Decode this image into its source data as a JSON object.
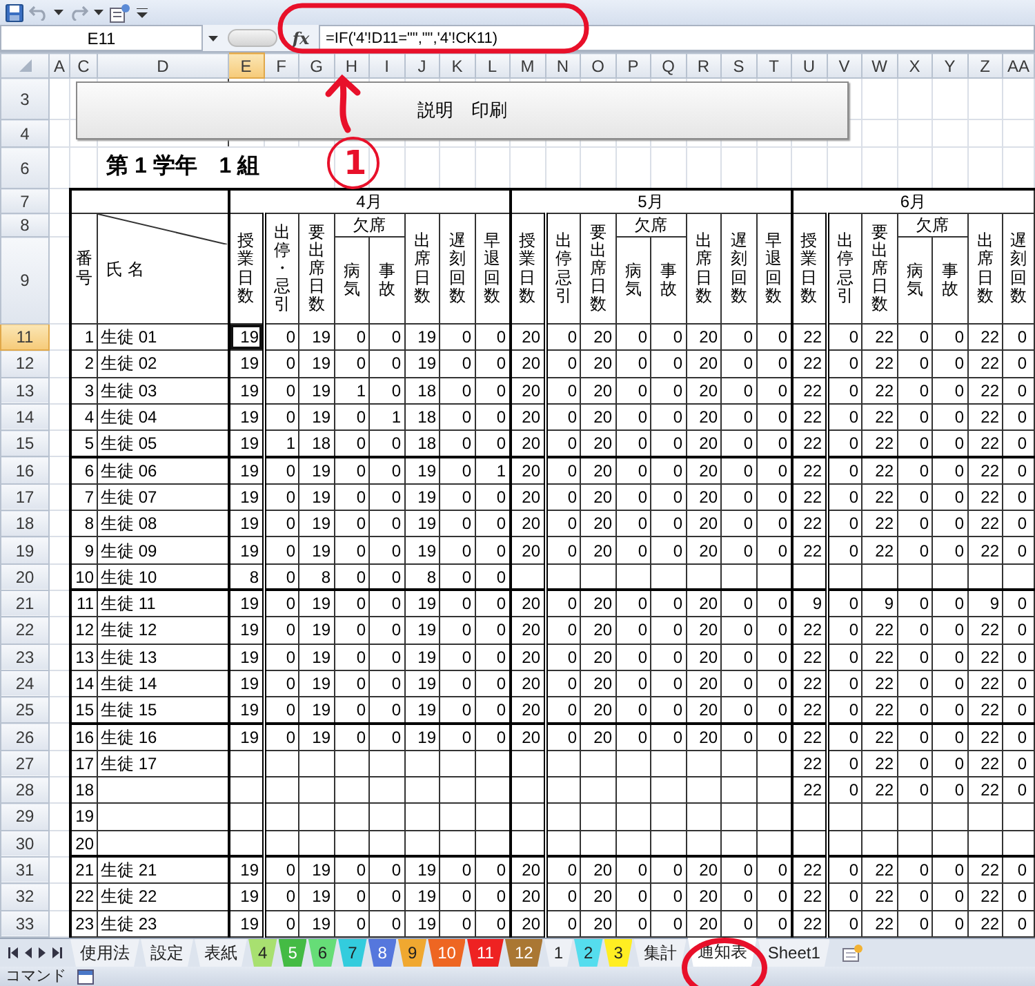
{
  "name_box": "E11",
  "function_button": "fx",
  "formula": "=IF('4'!D11=\"\",\"\",'4'!CK11)",
  "column_headers": [
    {
      "label": "A",
      "selected": false
    },
    {
      "label": "C",
      "selected": false
    },
    {
      "label": "D",
      "selected": false
    },
    {
      "label": "E",
      "selected": true
    },
    {
      "label": "F",
      "selected": false
    },
    {
      "label": "G",
      "selected": false
    },
    {
      "label": "H",
      "selected": false
    },
    {
      "label": "I",
      "selected": false
    },
    {
      "label": "J",
      "selected": false
    },
    {
      "label": "K",
      "selected": false
    },
    {
      "label": "L",
      "selected": false
    },
    {
      "label": "M",
      "selected": false
    },
    {
      "label": "N",
      "selected": false
    },
    {
      "label": "O",
      "selected": false
    },
    {
      "label": "P",
      "selected": false
    },
    {
      "label": "Q",
      "selected": false
    },
    {
      "label": "R",
      "selected": false
    },
    {
      "label": "S",
      "selected": false
    },
    {
      "label": "T",
      "selected": false
    },
    {
      "label": "U",
      "selected": false
    },
    {
      "label": "V",
      "selected": false
    },
    {
      "label": "W",
      "selected": false
    },
    {
      "label": "X",
      "selected": false
    },
    {
      "label": "Y",
      "selected": false
    },
    {
      "label": "Z",
      "selected": false
    },
    {
      "label": "AA",
      "selected": false
    }
  ],
  "row_headers": [
    {
      "label": "3",
      "selected": false
    },
    {
      "label": "4",
      "selected": false
    },
    {
      "label": "6",
      "selected": false
    },
    {
      "label": "7",
      "selected": false
    },
    {
      "label": "8",
      "selected": false
    },
    {
      "label": "9",
      "selected": false
    },
    {
      "label": "11",
      "selected": true
    },
    {
      "label": "12",
      "selected": false
    },
    {
      "label": "13",
      "selected": false
    },
    {
      "label": "14",
      "selected": false
    },
    {
      "label": "15",
      "selected": false
    },
    {
      "label": "16",
      "selected": false
    },
    {
      "label": "17",
      "selected": false
    },
    {
      "label": "18",
      "selected": false
    },
    {
      "label": "19",
      "selected": false
    },
    {
      "label": "20",
      "selected": false
    },
    {
      "label": "21",
      "selected": false
    },
    {
      "label": "22",
      "selected": false
    },
    {
      "label": "23",
      "selected": false
    },
    {
      "label": "24",
      "selected": false
    },
    {
      "label": "25",
      "selected": false
    },
    {
      "label": "26",
      "selected": false
    },
    {
      "label": "27",
      "selected": false
    },
    {
      "label": "28",
      "selected": false
    },
    {
      "label": "29",
      "selected": false
    },
    {
      "label": "30",
      "selected": false
    },
    {
      "label": "31",
      "selected": false
    },
    {
      "label": "32",
      "selected": false
    },
    {
      "label": "33",
      "selected": false
    }
  ],
  "sheet_button": {
    "label": "説明　印刷"
  },
  "sheet_title": "第 1 学年　1 組",
  "table_header": {
    "number": "番号",
    "name": "氏 名"
  },
  "months": [
    {
      "label": "4月",
      "group": "欠席",
      "headers": [
        {
          "label": "授業日数",
          "kind": "single"
        },
        {
          "label": "出停・忌引",
          "kind": "single"
        },
        {
          "label": "要出席日数",
          "kind": "single"
        },
        {
          "label": "病気",
          "kind": "sub"
        },
        {
          "label": "事故",
          "kind": "sub"
        },
        {
          "label": "出席日数",
          "kind": "single"
        },
        {
          "label": "遅刻回数",
          "kind": "single"
        },
        {
          "label": "早退回数",
          "kind": "single"
        }
      ]
    },
    {
      "label": "5月",
      "group": "欠席",
      "headers": [
        {
          "label": "授業日数",
          "kind": "single"
        },
        {
          "label": "出停忌引",
          "kind": "single"
        },
        {
          "label": "要出席日数",
          "kind": "single"
        },
        {
          "label": "病気",
          "kind": "sub"
        },
        {
          "label": "事故",
          "kind": "sub"
        },
        {
          "label": "出席日数",
          "kind": "single"
        },
        {
          "label": "遅刻回数",
          "kind": "single"
        },
        {
          "label": "早退回数",
          "kind": "single"
        }
      ]
    },
    {
      "label": "6月",
      "group": "欠席",
      "headers": [
        {
          "label": "授業日数",
          "kind": "single"
        },
        {
          "label": "出停忌引",
          "kind": "single"
        },
        {
          "label": "要出席日数",
          "kind": "single"
        },
        {
          "label": "病気",
          "kind": "sub"
        },
        {
          "label": "事故",
          "kind": "sub"
        },
        {
          "label": "出席日数",
          "kind": "single"
        },
        {
          "label": "遅刻回数",
          "kind": "single"
        }
      ]
    }
  ],
  "students": [
    {
      "number": "1",
      "name": "生徒 01",
      "april": [
        "19",
        "0",
        "19",
        "0",
        "0",
        "19",
        "0",
        "0"
      ],
      "may": [
        "20",
        "0",
        "20",
        "0",
        "0",
        "20",
        "0",
        "0"
      ],
      "june": [
        "22",
        "0",
        "22",
        "0",
        "0",
        "22",
        "0"
      ]
    },
    {
      "number": "2",
      "name": "生徒 02",
      "april": [
        "19",
        "0",
        "19",
        "0",
        "0",
        "19",
        "0",
        "0"
      ],
      "may": [
        "20",
        "0",
        "20",
        "0",
        "0",
        "20",
        "0",
        "0"
      ],
      "june": [
        "22",
        "0",
        "22",
        "0",
        "0",
        "22",
        "0"
      ]
    },
    {
      "number": "3",
      "name": "生徒 03",
      "april": [
        "19",
        "0",
        "19",
        "1",
        "0",
        "18",
        "0",
        "0"
      ],
      "may": [
        "20",
        "0",
        "20",
        "0",
        "0",
        "20",
        "0",
        "0"
      ],
      "june": [
        "22",
        "0",
        "22",
        "0",
        "0",
        "22",
        "0"
      ]
    },
    {
      "number": "4",
      "name": "生徒 04",
      "april": [
        "19",
        "0",
        "19",
        "0",
        "1",
        "18",
        "0",
        "0"
      ],
      "may": [
        "20",
        "0",
        "20",
        "0",
        "0",
        "20",
        "0",
        "0"
      ],
      "june": [
        "22",
        "0",
        "22",
        "0",
        "0",
        "22",
        "0"
      ]
    },
    {
      "number": "5",
      "name": "生徒 05",
      "april": [
        "19",
        "1",
        "18",
        "0",
        "0",
        "18",
        "0",
        "0"
      ],
      "may": [
        "20",
        "0",
        "20",
        "0",
        "0",
        "20",
        "0",
        "0"
      ],
      "june": [
        "22",
        "0",
        "22",
        "0",
        "0",
        "22",
        "0"
      ]
    },
    {
      "number": "6",
      "name": "生徒 06",
      "april": [
        "19",
        "0",
        "19",
        "0",
        "0",
        "19",
        "0",
        "1"
      ],
      "may": [
        "20",
        "0",
        "20",
        "0",
        "0",
        "20",
        "0",
        "0"
      ],
      "june": [
        "22",
        "0",
        "22",
        "0",
        "0",
        "22",
        "0"
      ]
    },
    {
      "number": "7",
      "name": "生徒 07",
      "april": [
        "19",
        "0",
        "19",
        "0",
        "0",
        "19",
        "0",
        "0"
      ],
      "may": [
        "20",
        "0",
        "20",
        "0",
        "0",
        "20",
        "0",
        "0"
      ],
      "june": [
        "22",
        "0",
        "22",
        "0",
        "0",
        "22",
        "0"
      ]
    },
    {
      "number": "8",
      "name": "生徒 08",
      "april": [
        "19",
        "0",
        "19",
        "0",
        "0",
        "19",
        "0",
        "0"
      ],
      "may": [
        "20",
        "0",
        "20",
        "0",
        "0",
        "20",
        "0",
        "0"
      ],
      "june": [
        "22",
        "0",
        "22",
        "0",
        "0",
        "22",
        "0"
      ]
    },
    {
      "number": "9",
      "name": "生徒 09",
      "april": [
        "19",
        "0",
        "19",
        "0",
        "0",
        "19",
        "0",
        "0"
      ],
      "may": [
        "20",
        "0",
        "20",
        "0",
        "0",
        "20",
        "0",
        "0"
      ],
      "june": [
        "22",
        "0",
        "22",
        "0",
        "0",
        "22",
        "0"
      ]
    },
    {
      "number": "10",
      "name": "生徒 10",
      "april": [
        "8",
        "0",
        "8",
        "0",
        "0",
        "8",
        "0",
        "0"
      ]
    },
    {
      "number": "11",
      "name": "生徒 11",
      "april": [
        "19",
        "0",
        "19",
        "0",
        "0",
        "19",
        "0",
        "0"
      ],
      "may": [
        "20",
        "0",
        "20",
        "0",
        "0",
        "20",
        "0",
        "0"
      ],
      "june": [
        "9",
        "0",
        "9",
        "0",
        "0",
        "9",
        "0"
      ]
    },
    {
      "number": "12",
      "name": "生徒 12",
      "april": [
        "19",
        "0",
        "19",
        "0",
        "0",
        "19",
        "0",
        "0"
      ],
      "may": [
        "20",
        "0",
        "20",
        "0",
        "0",
        "20",
        "0",
        "0"
      ],
      "june": [
        "22",
        "0",
        "22",
        "0",
        "0",
        "22",
        "0"
      ]
    },
    {
      "number": "13",
      "name": "生徒 13",
      "april": [
        "19",
        "0",
        "19",
        "0",
        "0",
        "19",
        "0",
        "0"
      ],
      "may": [
        "20",
        "0",
        "20",
        "0",
        "0",
        "20",
        "0",
        "0"
      ],
      "june": [
        "22",
        "0",
        "22",
        "0",
        "0",
        "22",
        "0"
      ]
    },
    {
      "number": "14",
      "name": "生徒 14",
      "april": [
        "19",
        "0",
        "19",
        "0",
        "0",
        "19",
        "0",
        "0"
      ],
      "may": [
        "20",
        "0",
        "20",
        "0",
        "0",
        "20",
        "0",
        "0"
      ],
      "june": [
        "22",
        "0",
        "22",
        "0",
        "0",
        "22",
        "0"
      ]
    },
    {
      "number": "15",
      "name": "生徒 15",
      "april": [
        "19",
        "0",
        "19",
        "0",
        "0",
        "19",
        "0",
        "0"
      ],
      "may": [
        "20",
        "0",
        "20",
        "0",
        "0",
        "20",
        "0",
        "0"
      ],
      "june": [
        "22",
        "0",
        "22",
        "0",
        "0",
        "22",
        "0"
      ]
    },
    {
      "number": "16",
      "name": "生徒 16",
      "april": [
        "19",
        "0",
        "19",
        "0",
        "0",
        "19",
        "0",
        "0"
      ],
      "may": [
        "20",
        "0",
        "20",
        "0",
        "0",
        "20",
        "0",
        "0"
      ],
      "june": [
        "22",
        "0",
        "22",
        "0",
        "0",
        "22",
        "0"
      ]
    },
    {
      "number": "17",
      "name": "生徒 17",
      "june": [
        "22",
        "0",
        "22",
        "0",
        "0",
        "22",
        "0"
      ]
    },
    {
      "number": "18",
      "june": [
        "22",
        "0",
        "22",
        "0",
        "0",
        "22",
        "0"
      ]
    },
    {
      "number": "19"
    },
    {
      "number": "20"
    },
    {
      "number": "21",
      "name": "生徒 21",
      "april": [
        "19",
        "0",
        "19",
        "0",
        "0",
        "19",
        "0",
        "0"
      ],
      "may": [
        "20",
        "0",
        "20",
        "0",
        "0",
        "20",
        "0",
        "0"
      ],
      "june": [
        "22",
        "0",
        "22",
        "0",
        "0",
        "22",
        "0"
      ]
    },
    {
      "number": "22",
      "name": "生徒 22",
      "april": [
        "19",
        "0",
        "19",
        "0",
        "0",
        "19",
        "0",
        "0"
      ],
      "may": [
        "20",
        "0",
        "20",
        "0",
        "0",
        "20",
        "0",
        "0"
      ],
      "june": [
        "22",
        "0",
        "22",
        "0",
        "0",
        "22",
        "0"
      ]
    },
    {
      "number": "23",
      "name": "生徒 23",
      "april": [
        "19",
        "0",
        "19",
        "0",
        "0",
        "19",
        "0",
        "0"
      ],
      "may": [
        "20",
        "0",
        "20",
        "0",
        "0",
        "20",
        "0",
        "0"
      ],
      "june": [
        "22",
        "0",
        "22",
        "0",
        "0",
        "22",
        "0"
      ]
    }
  ],
  "sheet_tabs": [
    {
      "label": "使用法",
      "selected": false
    },
    {
      "label": "設定",
      "selected": false
    },
    {
      "label": "表紙",
      "selected": false
    },
    {
      "label": "4",
      "selected": false,
      "color": "#a8e070"
    },
    {
      "label": "5",
      "selected": false,
      "color": "#44bb44"
    },
    {
      "label": "6",
      "selected": false,
      "color": "#66dd77"
    },
    {
      "label": "7",
      "selected": false,
      "color": "#33ccdd"
    },
    {
      "label": "8",
      "selected": false,
      "color": "#5577dd"
    },
    {
      "label": "9",
      "selected": false,
      "color": "#f0a830"
    },
    {
      "label": "10",
      "selected": false,
      "color": "#ee6622"
    },
    {
      "label": "11",
      "selected": false,
      "color": "#ee2222"
    },
    {
      "label": "12",
      "selected": false,
      "color": "#aa7733"
    },
    {
      "label": "1",
      "selected": false
    },
    {
      "label": "2",
      "selected": false,
      "color": "#55ddee"
    },
    {
      "label": "3",
      "selected": false,
      "color": "#ffee22"
    },
    {
      "label": "集計",
      "selected": false
    },
    {
      "label": "通知表",
      "selected": true
    },
    {
      "label": "Sheet1",
      "selected": false
    }
  ],
  "status_bar": {
    "text": "コマンド"
  },
  "annotation": {
    "label": "1"
  }
}
